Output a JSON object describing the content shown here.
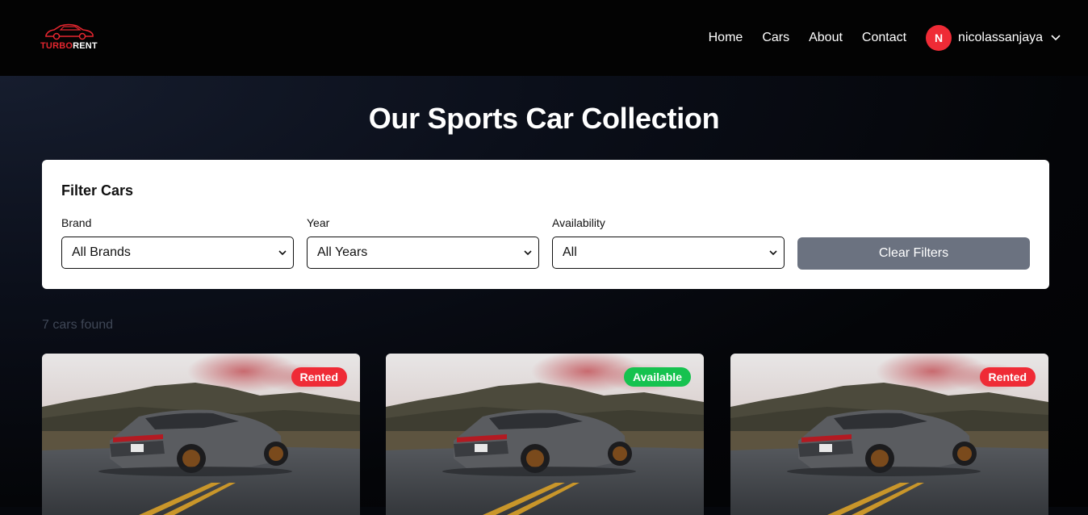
{
  "brand": {
    "name_turbo": "TURBO",
    "name_rent": "RENT",
    "logo_icon": "car-icon"
  },
  "nav": {
    "links": [
      "Home",
      "Cars",
      "About",
      "Contact"
    ],
    "user": {
      "initial": "N",
      "name": "nicolassanjaya"
    }
  },
  "page": {
    "title": "Our Sports Car Collection"
  },
  "filters": {
    "title": "Filter Cars",
    "brand": {
      "label": "Brand",
      "value": "All Brands"
    },
    "year": {
      "label": "Year",
      "value": "All Years"
    },
    "availability": {
      "label": "Availability",
      "value": "All"
    },
    "clear_label": "Clear Filters"
  },
  "results": {
    "count_text": "7 cars found"
  },
  "cars": [
    {
      "status": "Rented",
      "status_color": "#ef2b36"
    },
    {
      "status": "Available",
      "status_color": "#16c24f"
    },
    {
      "status": "Rented",
      "status_color": "#ef2b36"
    }
  ],
  "colors": {
    "accent": "#ef2b36",
    "button_gray": "#6b7280",
    "available": "#16c24f"
  }
}
